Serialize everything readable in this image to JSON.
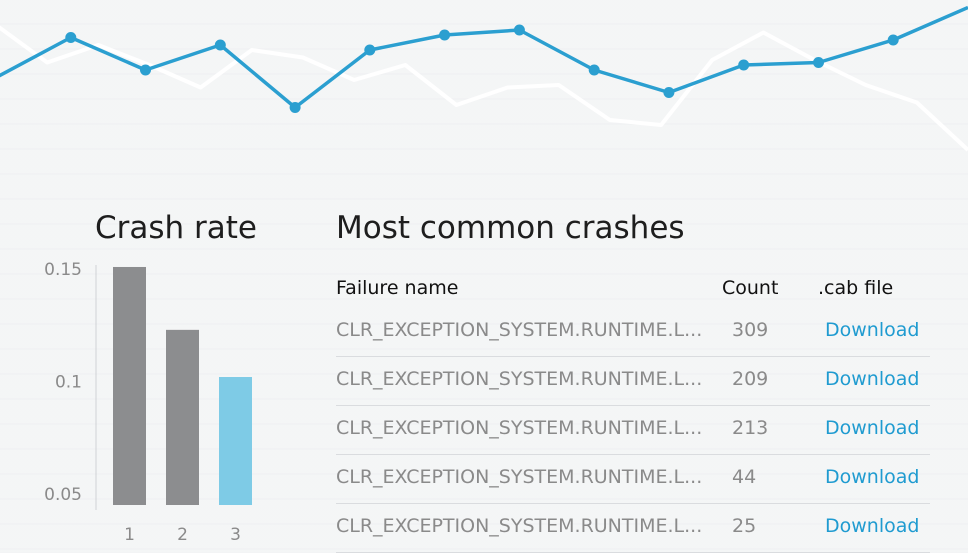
{
  "trend_chart": {
    "type": "line",
    "series": [
      {
        "values": [
          70,
          55,
          62,
          54,
          45,
          60,
          57,
          48,
          54,
          38,
          45,
          46,
          32,
          30,
          56,
          67,
          56,
          46,
          39,
          20
        ],
        "color": "#ffffff"
      },
      {
        "values": [
          49,
          65,
          52,
          62,
          37,
          60,
          66,
          68,
          52,
          43,
          54,
          55,
          64,
          77
        ],
        "color": "#2b9fd0"
      }
    ],
    "ylim": [
      0,
      80
    ]
  },
  "chart_data": {
    "type": "bar",
    "title": "Crash rate",
    "categories": [
      "1",
      "2",
      "3"
    ],
    "values": [
      0.151,
      0.123,
      0.102
    ],
    "highlight_index": 2,
    "colors": {
      "normal": "#8c8d8f",
      "highlight": "#7ecbe6"
    },
    "ylim": [
      0.045,
      0.155
    ],
    "yticks": [
      {
        "value": 0.15,
        "label": "0.15"
      },
      {
        "value": 0.1,
        "label": "0.1"
      },
      {
        "value": 0.05,
        "label": "0.05"
      }
    ]
  },
  "crashes": {
    "title": "Most common crashes",
    "headers": {
      "name": "Failure name",
      "count": "Count",
      "cab": ".cab file"
    },
    "rows": [
      {
        "name": "CLR_EXCEPTION_SYSTEM.RUNTIME.L...",
        "count": "309",
        "action": "Download"
      },
      {
        "name": "CLR_EXCEPTION_SYSTEM.RUNTIME.L...",
        "count": "209",
        "action": "Download"
      },
      {
        "name": "CLR_EXCEPTION_SYSTEM.RUNTIME.L...",
        "count": "213",
        "action": "Download"
      },
      {
        "name": "CLR_EXCEPTION_SYSTEM.RUNTIME.L...",
        "count": "44",
        "action": "Download"
      },
      {
        "name": "CLR_EXCEPTION_SYSTEM.RUNTIME.L...",
        "count": "25",
        "action": "Download"
      }
    ]
  }
}
